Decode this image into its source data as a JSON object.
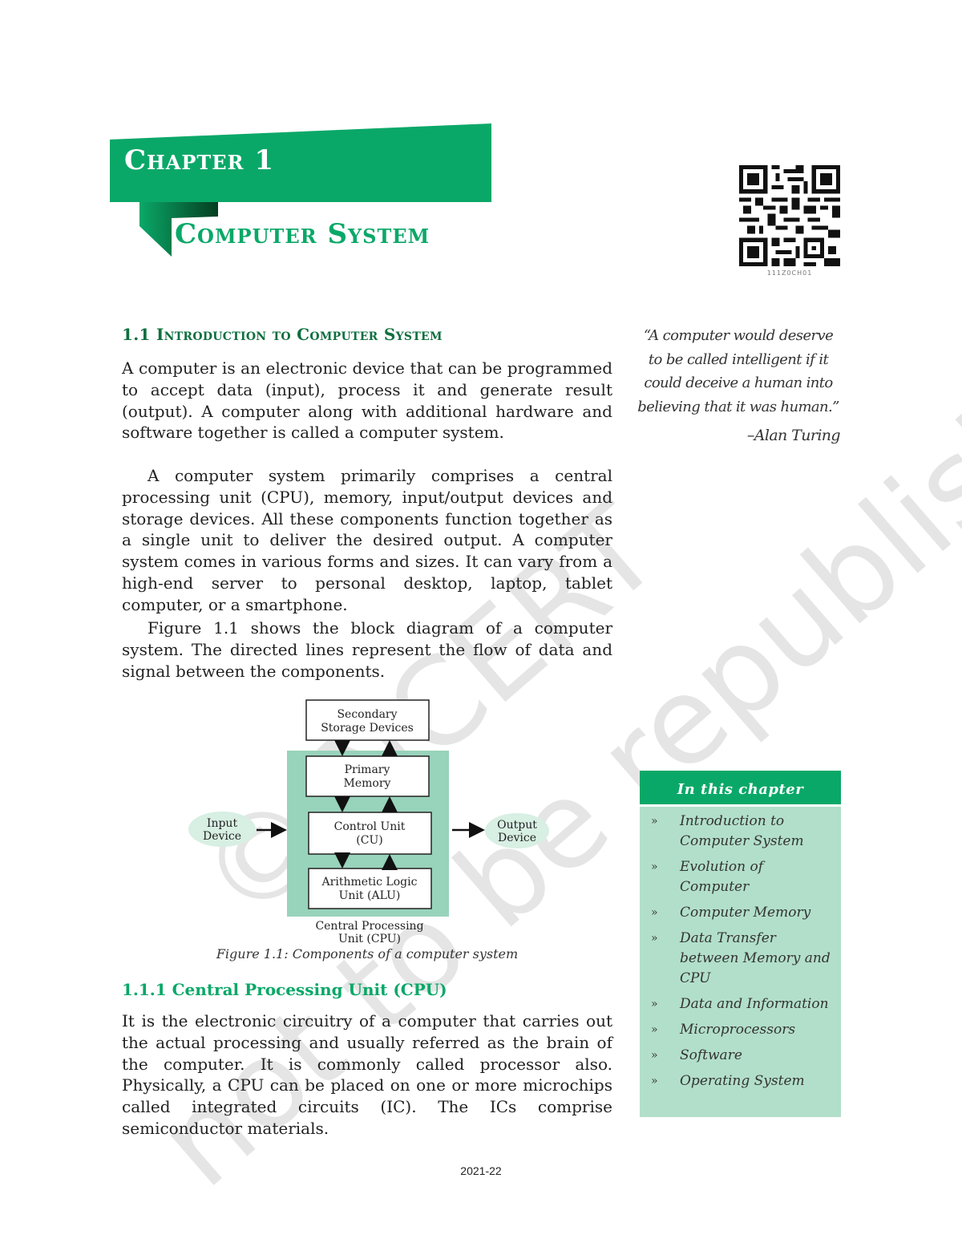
{
  "banner": {
    "chapter_label": "Chapter 1",
    "chapter_title": "Computer System",
    "colors": {
      "primary_green": "#0aa868",
      "dark_green": "#0e6f3f",
      "fold_green": "#0b5e34"
    }
  },
  "qr": {
    "caption": "111Z0CH01"
  },
  "quote": {
    "lines": [
      "“A computer would deserve",
      "to be called intelligent if it",
      "could deceive a human into",
      "believing that it was human.”"
    ],
    "author": "–Alan Turing"
  },
  "section": {
    "heading": "1.1 Introduction to Computer System",
    "paragraphs": [
      "A computer is an electronic device that can be programmed to accept data (input), process it and generate result (output). A computer along with additional hardware and software together is called a computer system.",
      "A computer system primarily comprises a central processing unit (CPU), memory, input/output devices and storage devices. All these components function together as a single unit to deliver the desired output. A computer system comes in various forms and sizes. It can vary from a high-end server to personal desktop, laptop, tablet computer, or a smartphone.",
      "Figure 1.1 shows the block diagram of a computer system. The directed lines represent the flow of data and signal between the components."
    ]
  },
  "figure": {
    "secondary_storage": [
      "Secondary",
      "Storage Devices"
    ],
    "primary_memory": [
      "Primary",
      "Memory"
    ],
    "control_unit": [
      "Control Unit",
      "(CU)"
    ],
    "alu": [
      "Arithmetic Logic",
      "Unit (ALU)"
    ],
    "input_device": [
      "Input",
      "Device"
    ],
    "output_device": [
      "Output",
      "Device"
    ],
    "cpu_label": [
      "Central Processing",
      "Unit (CPU)"
    ],
    "caption": "Figure 1.1: Components of a computer system",
    "colors": {
      "cpu_fill": "#98d3bb",
      "device_fill": "#d8efe3"
    }
  },
  "subsection": {
    "heading": "1.1.1 Central Processing Unit (CPU)",
    "paragraph": "It is the electronic circuitry of a computer that carries out the actual processing and usually referred as the brain of the computer. It is commonly called processor also. Physically, a CPU can be placed on one or more microchips called integrated circuits (IC). The ICs comprise semiconductor materials."
  },
  "chapter_box": {
    "heading": "In this chapter",
    "bullet": "»",
    "items": [
      "Introduction to Computer System",
      "Evolution of Computer",
      "Computer Memory",
      "Data Transfer between Memory and CPU",
      "Data and Information",
      "Microprocessors",
      "Software",
      "Operating System"
    ]
  },
  "watermark": {
    "line1": "© NCERT",
    "line2": "not to be republished"
  },
  "footer": {
    "year": "2021-22"
  }
}
